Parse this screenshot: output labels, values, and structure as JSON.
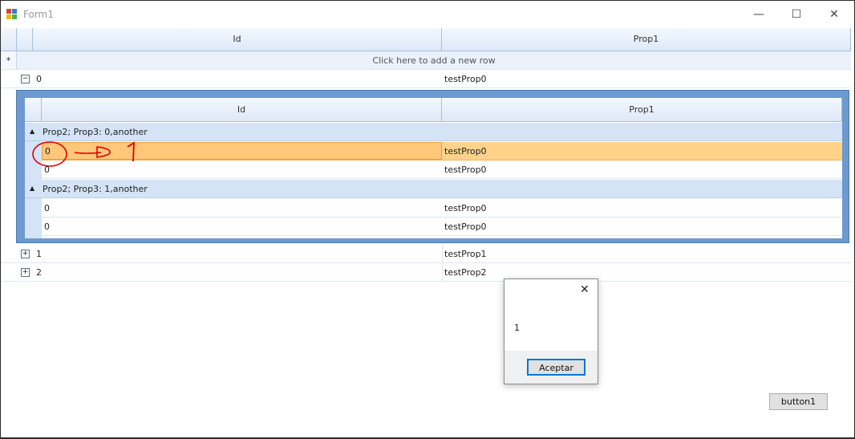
{
  "window": {
    "title": "Form1",
    "minimize_glyph": "—",
    "maximize_glyph": "☐",
    "close_glyph": "✕"
  },
  "grid": {
    "columns": [
      "Id",
      "Prop1"
    ],
    "new_row_text": "Click here to add a new row",
    "new_row_marker": "*",
    "rows": [
      {
        "id": "0",
        "prop1": "testProp0",
        "expanded": true
      },
      {
        "id": "1",
        "prop1": "testProp1",
        "expanded": false
      },
      {
        "id": "2",
        "prop1": "testProp2",
        "expanded": false
      }
    ],
    "expanded_glyph": "−",
    "collapsed_glyph": "+"
  },
  "detail": {
    "columns": [
      "Id",
      "Prop1"
    ],
    "groups": [
      {
        "label": "Prop2; Prop3: 0,another",
        "rows": [
          {
            "id": "0",
            "prop1": "testProp0"
          },
          {
            "id": "0",
            "prop1": "testProp0"
          }
        ]
      },
      {
        "label": "Prop2; Prop3: 1,another",
        "rows": [
          {
            "id": "0",
            "prop1": "testProp0"
          },
          {
            "id": "0",
            "prop1": "testProp0"
          }
        ]
      }
    ],
    "group_glyph": "▲"
  },
  "message_box": {
    "text": "1",
    "ok_label": "Aceptar",
    "close_glyph": "✕"
  },
  "button1": {
    "label": "button1"
  },
  "colors": {
    "selected_row": "#ffd28a",
    "selected_border": "#e8a040",
    "annotation": "#e00000",
    "header": "#dde8f8"
  }
}
